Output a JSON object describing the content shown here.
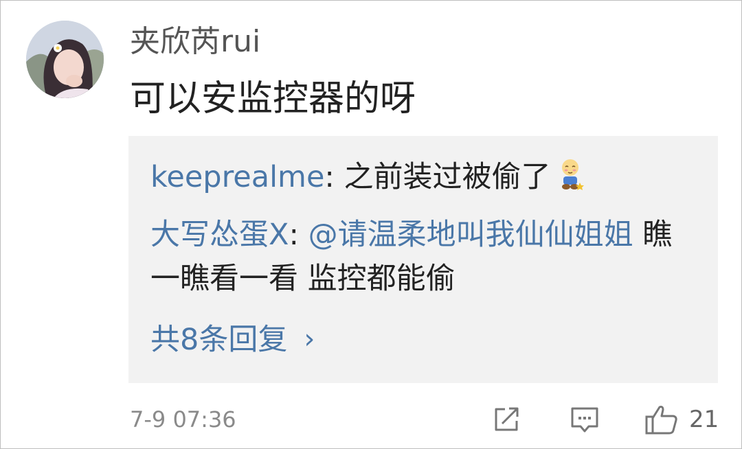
{
  "comment": {
    "username": "夹欣芮rui",
    "text": "可以安监控器的呀",
    "timestamp": "7-9 07:36",
    "like_count": "21"
  },
  "replies": [
    {
      "user": "keeprealme",
      "separator": ": ",
      "text": "之前装过被偷了",
      "emoji": "shy-sitting-emoji"
    },
    {
      "user": "大写怂蛋X",
      "separator": ": ",
      "mention": "@请温柔地叫我仙仙姐姐",
      "text": " 瞧一瞧看一看 监控都能偷"
    }
  ],
  "more_replies": {
    "label": "共8条回复",
    "chevron": "›"
  },
  "icons": {
    "share": "share-icon",
    "comment": "comment-icon",
    "like": "thumbs-up-icon"
  },
  "colors": {
    "link": "#4a77a8",
    "reply_box": "#f2f2f2",
    "muted": "#8a8a8a"
  }
}
